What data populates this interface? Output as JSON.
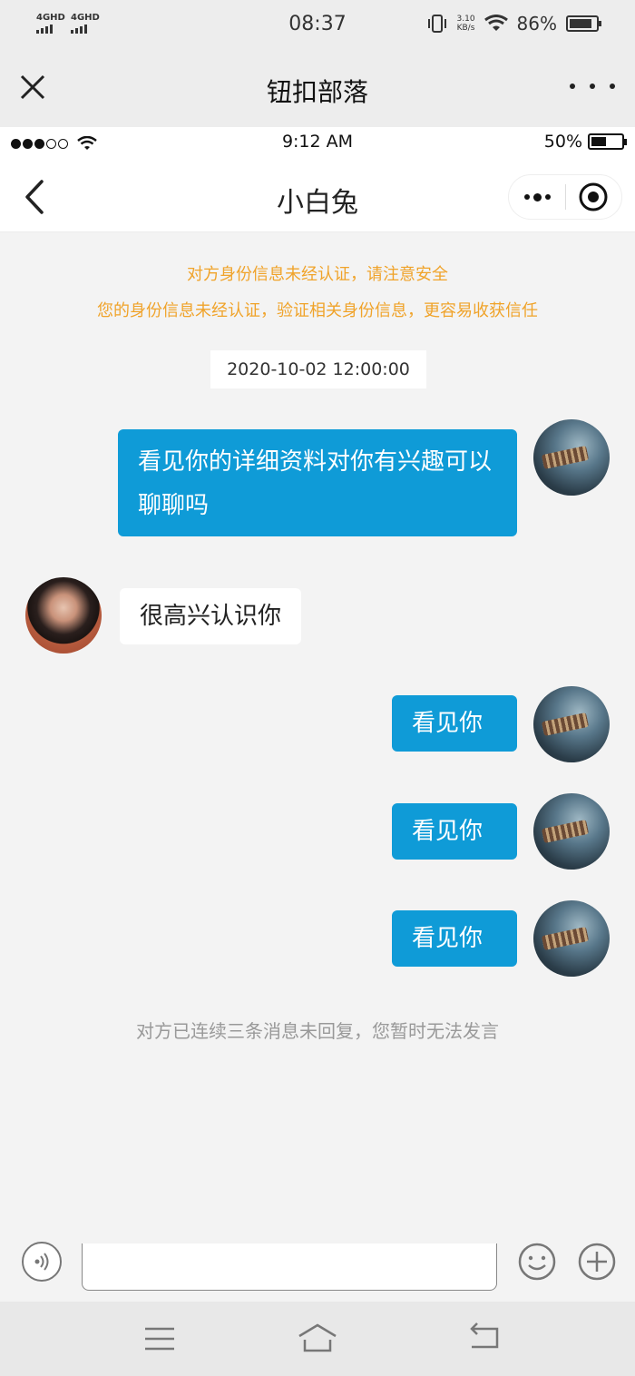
{
  "os_status": {
    "network1": "4GHD",
    "network2": "4GHD",
    "time": "08:37",
    "speed_value": "3.10",
    "speed_unit": "KB/s",
    "battery": "86%",
    "battery_level": 0.86
  },
  "miniprogram_bar": {
    "title": "钮扣部落",
    "close_icon": "close-icon",
    "more_icon": "more-dots-icon"
  },
  "ios_status": {
    "time": "9:12 AM",
    "battery": "50%",
    "battery_level": 0.5
  },
  "chat_header": {
    "title": "小白兔"
  },
  "notices": {
    "line1": "对方身份信息未经认证，请注意安全",
    "line2": "您的身份信息未经认证，验证相关身份信息，更容易收获信任"
  },
  "timestamp": "2020-10-02  12:00:00",
  "messages": [
    {
      "direction": "out",
      "text": "看见你的详细资料对你有兴趣可以聊聊吗"
    },
    {
      "direction": "in",
      "text": "很高兴认识你"
    },
    {
      "direction": "out",
      "text": "看见你"
    },
    {
      "direction": "out",
      "text": "看见你"
    },
    {
      "direction": "out",
      "text": "看见你"
    }
  ],
  "system_message": "对方已连续三条消息未回复，您暂时无法发言",
  "input": {
    "value": "",
    "placeholder": ""
  },
  "colors": {
    "outgoing_bubble": "#0f9bd7",
    "notice_text": "#f0a32a",
    "system_text": "#999999"
  }
}
